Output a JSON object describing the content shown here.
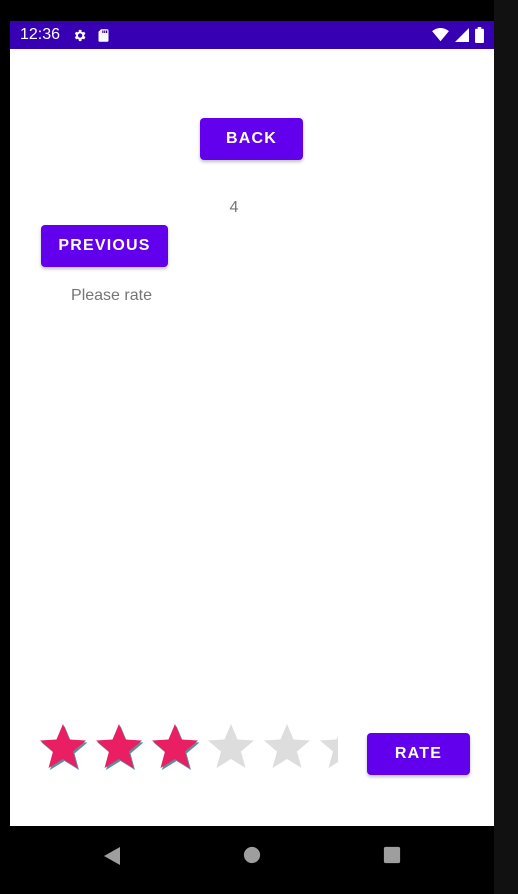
{
  "status_bar": {
    "time": "12:36",
    "background": "#3700b3",
    "icons_left": [
      "gear-icon",
      "sd-card-icon"
    ],
    "icons_right": [
      "wifi-icon",
      "signal-icon",
      "battery-icon"
    ]
  },
  "screen": {
    "back_label": "BACK",
    "count": "4",
    "previous_label": "PREVIOUS",
    "prompt": "Please rate",
    "rate_label": "RATE"
  },
  "rating": {
    "value": 3,
    "max": 5,
    "filled_color": "#e91e63",
    "empty_color": "#dddddd"
  },
  "colors": {
    "accent": "#6200ee",
    "status": "#3700b3",
    "text_secondary": "#757575"
  },
  "navigation": {
    "icons": [
      "back-triangle-icon",
      "home-circle-icon",
      "recents-square-icon"
    ]
  }
}
